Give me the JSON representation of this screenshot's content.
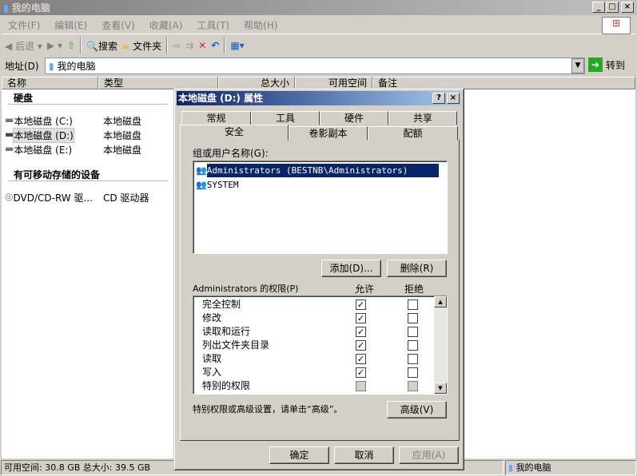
{
  "window": {
    "title": "我的电脑"
  },
  "menu": [
    "文件(F)",
    "编辑(E)",
    "查看(V)",
    "收藏(A)",
    "工具(T)",
    "帮助(H)"
  ],
  "toolbar": {
    "back": "后退",
    "search": "搜索",
    "folders": "文件夹"
  },
  "address": {
    "label": "地址(D)",
    "value": "我的电脑",
    "go": "转到"
  },
  "columns": [
    "名称",
    "类型",
    "总大小",
    "可用空间",
    "备注"
  ],
  "groups": [
    {
      "title": "硬盘",
      "items": [
        {
          "name": "本地磁盘 (C:)",
          "type": "本地磁盘"
        },
        {
          "name": "本地磁盘 (D:)",
          "type": "本地磁盘"
        },
        {
          "name": "本地磁盘 (E:)",
          "type": "本地磁盘"
        }
      ]
    },
    {
      "title": "有可移动存储的设备",
      "items": [
        {
          "name": "DVD/CD-RW 驱...",
          "type": "CD 驱动器"
        }
      ]
    }
  ],
  "status": {
    "left": "可用空间: 30.8 GB 总大小: 39.5 GB",
    "right": "我的电脑"
  },
  "dialog": {
    "title": "本地磁盘 (D:) 属性",
    "tabs_back": [
      "常规",
      "工具",
      "硬件",
      "共享"
    ],
    "tabs_front": [
      "安全",
      "卷影副本",
      "配额"
    ],
    "active_tab": "安全",
    "users_label": "组或用户名称(G):",
    "users": [
      "Administrators (BESTNB\\Administrators)",
      "SYSTEM"
    ],
    "add": "添加(D)...",
    "remove": "删除(R)",
    "perm_label": "Administrators 的权限(P)",
    "allow": "允许",
    "deny": "拒绝",
    "permissions": [
      {
        "name": "完全控制",
        "allow": true,
        "deny": false
      },
      {
        "name": "修改",
        "allow": true,
        "deny": false
      },
      {
        "name": "读取和运行",
        "allow": true,
        "deny": false
      },
      {
        "name": "列出文件夹目录",
        "allow": true,
        "deny": false
      },
      {
        "name": "读取",
        "allow": true,
        "deny": false
      },
      {
        "name": "写入",
        "allow": true,
        "deny": false
      },
      {
        "name": "特别的权限",
        "allow": false,
        "deny": false,
        "disabled": true
      }
    ],
    "advanced_hint": "特别权限或高级设置，请单击“高级”。",
    "advanced": "高级(V)",
    "ok": "确定",
    "cancel": "取消",
    "apply": "应用(A)"
  }
}
